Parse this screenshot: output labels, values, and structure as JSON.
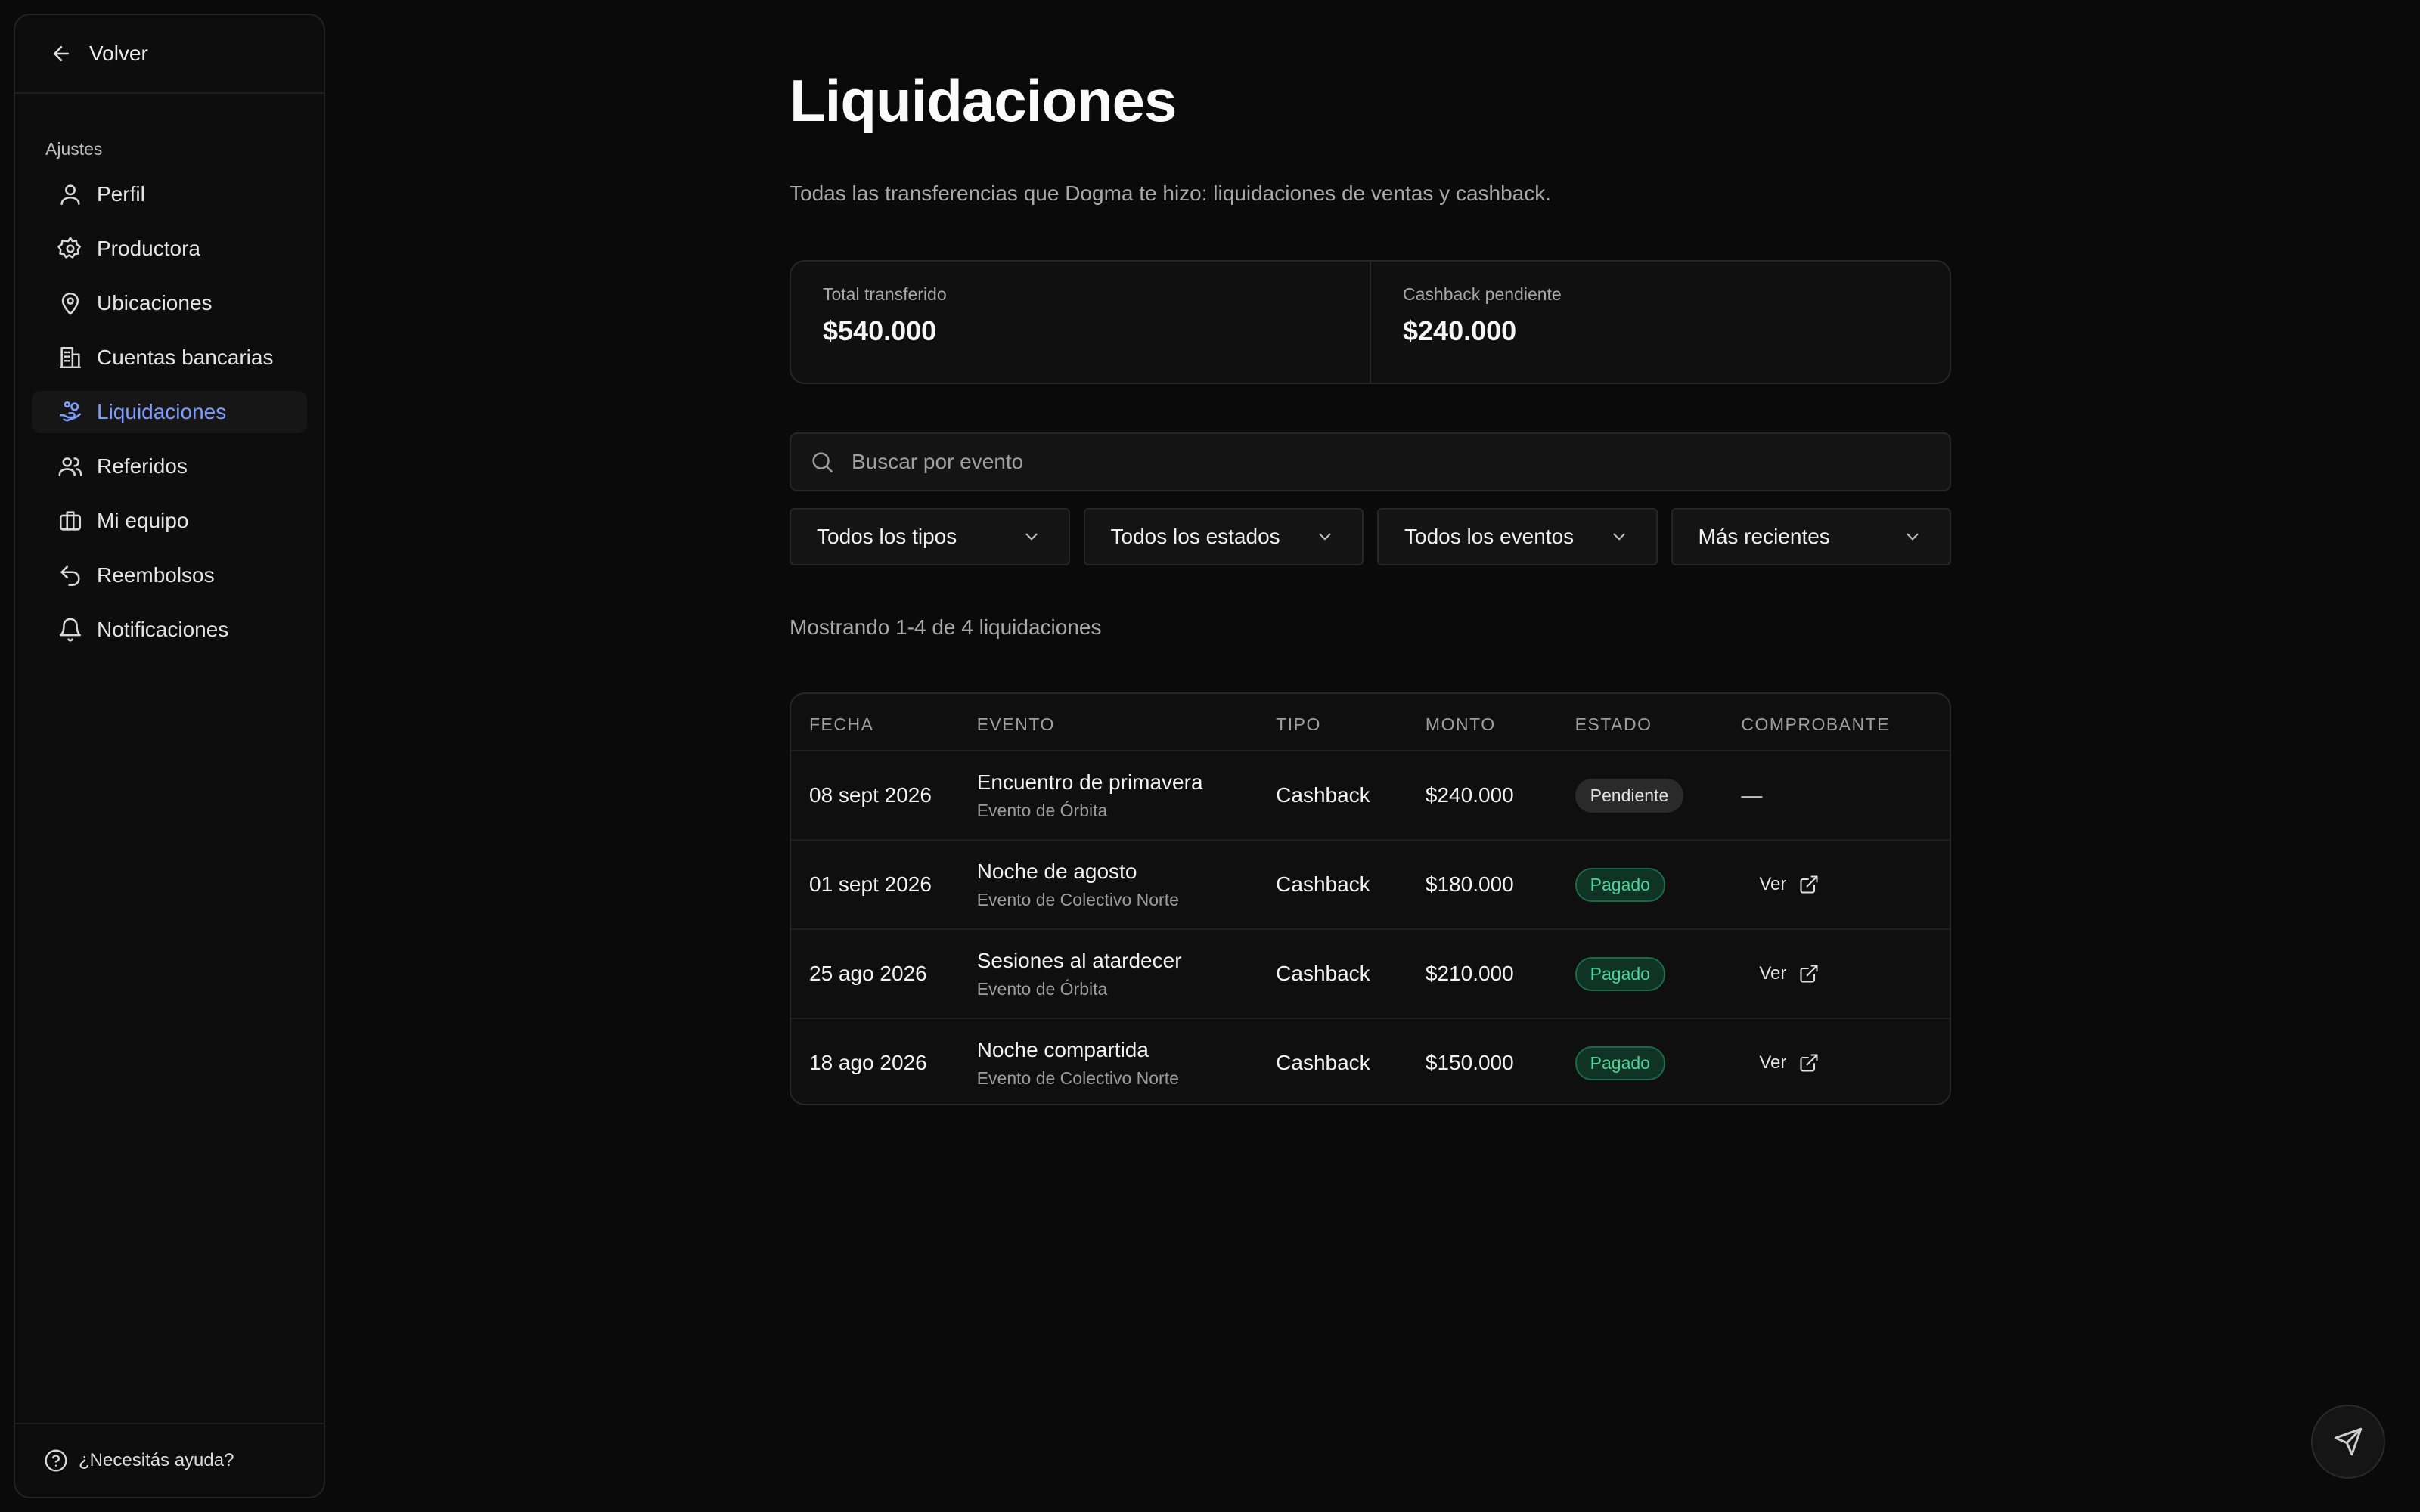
{
  "sidebar": {
    "back_label": "Volver",
    "section_label": "Ajustes",
    "items": [
      {
        "label": "Perfil",
        "icon": "user-icon"
      },
      {
        "label": "Productora",
        "icon": "gear-icon"
      },
      {
        "label": "Ubicaciones",
        "icon": "map-pin-icon"
      },
      {
        "label": "Cuentas bancarias",
        "icon": "bank-icon"
      },
      {
        "label": "Liquidaciones",
        "icon": "hand-coins-icon",
        "active": true
      },
      {
        "label": "Referidos",
        "icon": "users-icon"
      },
      {
        "label": "Mi equipo",
        "icon": "briefcase-icon"
      },
      {
        "label": "Reembolsos",
        "icon": "undo-icon"
      },
      {
        "label": "Notificaciones",
        "icon": "bell-icon"
      }
    ],
    "help_label": "¿Necesitás ayuda?"
  },
  "page": {
    "title": "Liquidaciones",
    "subtitle": "Todas las transferencias que Dogma te hizo: liquidaciones de ventas y cashback."
  },
  "stats": {
    "total_label": "Total transferido",
    "total_value": "$540.000",
    "pending_label": "Cashback pendiente",
    "pending_value": "$240.000"
  },
  "search": {
    "placeholder": "Buscar por evento"
  },
  "filters": {
    "type": "Todos los tipos",
    "status": "Todos los estados",
    "event": "Todos los eventos",
    "sort": "Más recientes"
  },
  "showing_text": "Mostrando 1-4 de 4 liquidaciones",
  "table": {
    "headers": {
      "date": "Fecha",
      "event": "Evento",
      "type": "Tipo",
      "amount": "Monto",
      "status": "Estado",
      "receipt": "Comprobante"
    },
    "rows": [
      {
        "date": "08 sept 2026",
        "event": "Encuentro de primavera",
        "event_sub": "Evento de Órbita",
        "type": "Cashback",
        "amount": "$240.000",
        "status": "Pendiente",
        "receipt": "—"
      },
      {
        "date": "01 sept 2026",
        "event": "Noche de agosto",
        "event_sub": "Evento de Colectivo Norte",
        "type": "Cashback",
        "amount": "$180.000",
        "status": "Pagado",
        "receipt": "Ver"
      },
      {
        "date": "25 ago 2026",
        "event": "Sesiones al atardecer",
        "event_sub": "Evento de Órbita",
        "type": "Cashback",
        "amount": "$210.000",
        "status": "Pagado",
        "receipt": "Ver"
      },
      {
        "date": "18 ago 2026",
        "event": "Noche compartida",
        "event_sub": "Evento de Colectivo Norte",
        "type": "Cashback",
        "amount": "$150.000",
        "status": "Pagado",
        "receipt": "Ver"
      }
    ]
  },
  "colors": {
    "background": "#0a0a0a",
    "accent": "#7f9cff",
    "paid_text": "#4fd39a",
    "paid_bg": "#0f3324",
    "pending_bg": "#2a2a2a"
  },
  "fab_icon": "send-icon"
}
